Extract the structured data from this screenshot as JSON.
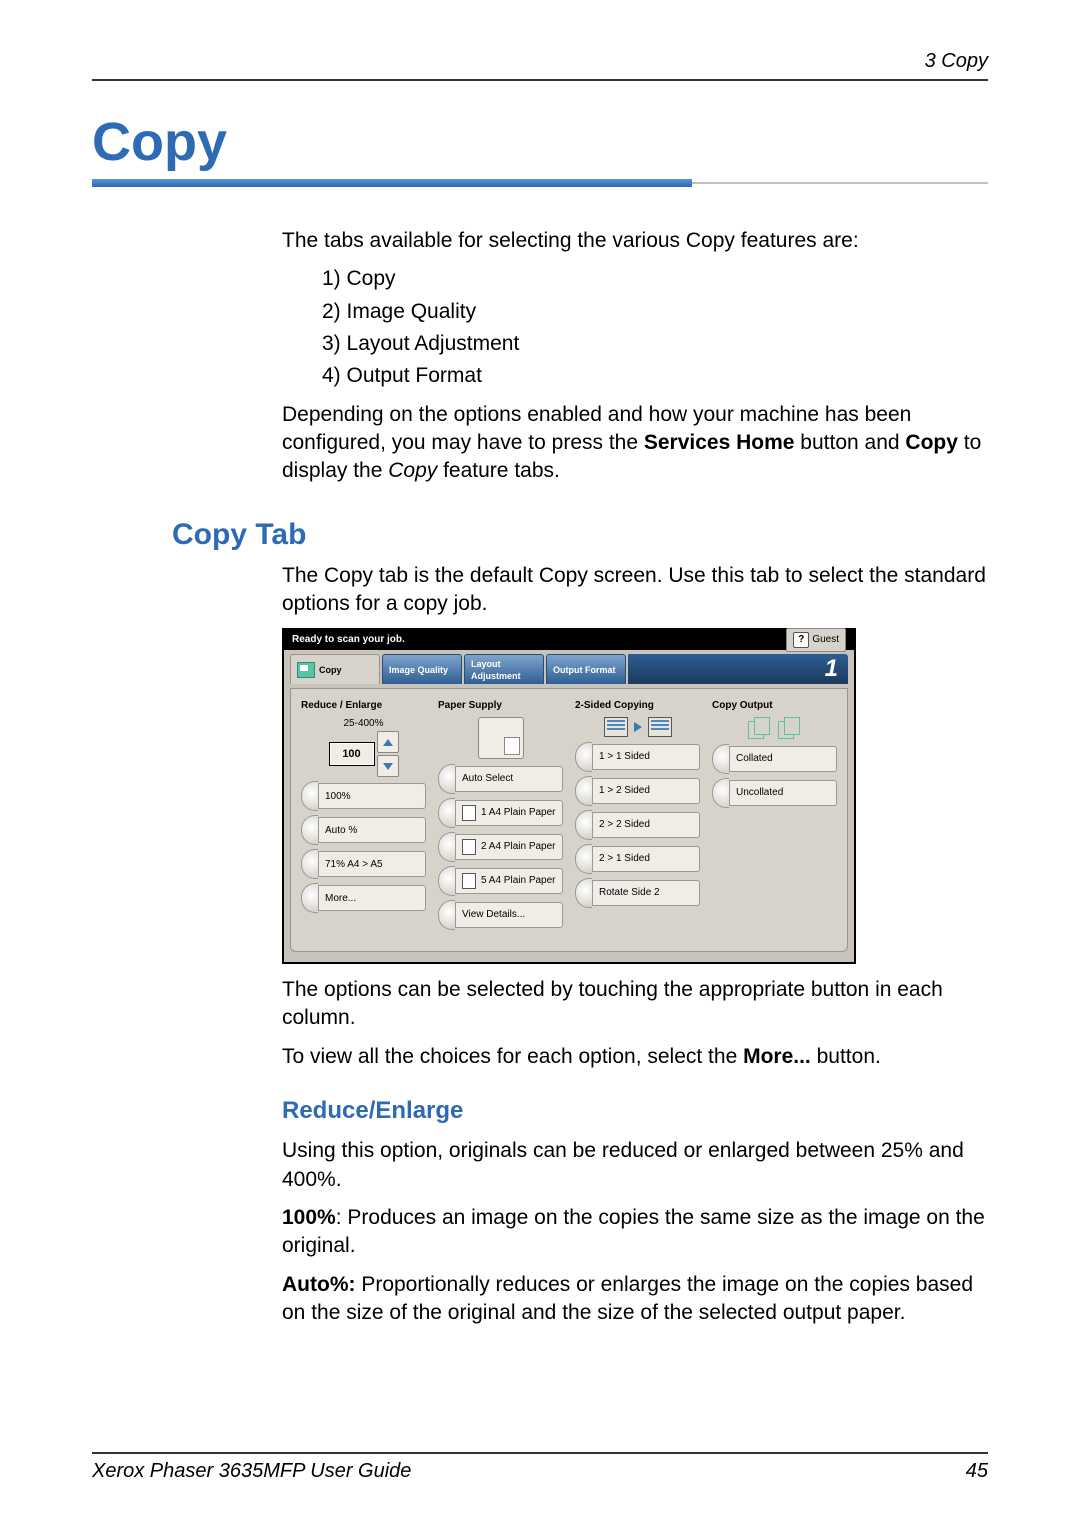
{
  "header": {
    "chapter": "3   Copy"
  },
  "title": "Copy",
  "intro": "The tabs available for selecting the various Copy features are:",
  "tab_list": [
    "Copy",
    "Image Quality",
    "Layout Adjustment",
    "Output Format"
  ],
  "para_depending_pre": "Depending on the options enabled and how your machine has been configured, you may have to press the ",
  "bold_services_home": "Services Home",
  "para_depending_mid": " button and ",
  "bold_copy": "Copy",
  "para_depending_post": " to display the ",
  "italic_copy": "Copy",
  "para_depending_end": " feature tabs.",
  "h2_copy_tab": "Copy Tab",
  "para_copy_tab": "The Copy tab is the default Copy screen. Use this tab to select the standard options for a copy job.",
  "para_after_shot": "The options can be selected by touching the appropriate button in each column.",
  "para_more_pre": "To view all the choices for each option, select the ",
  "bold_more": "More...",
  "para_more_post": " button.",
  "h3_reduce": "Reduce/Enlarge",
  "para_reduce": "Using this option, originals can be reduced or enlarged between 25% and 400%.",
  "bold_100": "100%",
  "para_100": ":  Produces an image on the copies the same size as the image on the original.",
  "bold_auto": "Auto%:",
  "para_auto": "  Proportionally reduces or enlarges the image on the copies based on the size of the original and the size of the selected output paper.",
  "ui": {
    "status": "Ready to scan your job.",
    "guest": "Guest",
    "tabs": {
      "copy": "Copy",
      "iq": "Image Quality",
      "la1": "Layout",
      "la2": "Adjustment",
      "of": "Output Format"
    },
    "counter": "1",
    "cols": {
      "reduce": "Reduce / Enlarge",
      "paper": "Paper Supply",
      "sides": "2-Sided Copying",
      "output": "Copy Output"
    },
    "reduce": {
      "range": "25-400%",
      "value": "100",
      "b_100": "100%",
      "b_auto": "Auto %",
      "b_71": "71% A4 > A5",
      "b_more": "More..."
    },
    "paper": {
      "b_auto": "Auto Select",
      "b_1": "1  A4 Plain Paper",
      "b_2": "2  A4 Plain Paper",
      "b_5": "5  A4 Plain Paper",
      "b_view": "View Details..."
    },
    "sides": {
      "b_11": "1 > 1 Sided",
      "b_12": "1 > 2 Sided",
      "b_22": "2 > 2 Sided",
      "b_21": "2 > 1 Sided",
      "b_rot": "Rotate Side 2"
    },
    "output": {
      "b_col": "Collated",
      "b_unc": "Uncollated"
    }
  },
  "footer": {
    "left": "Xerox Phaser 3635MFP User Guide",
    "right": "45"
  },
  "chart_data": null
}
